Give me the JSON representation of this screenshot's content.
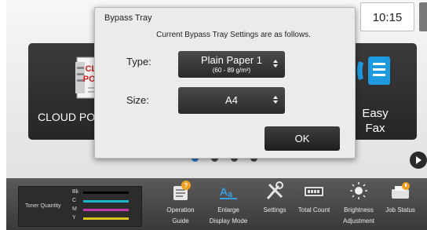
{
  "status": {
    "time": "10:15"
  },
  "tiles": {
    "cloud_portal": {
      "label": "CLOUD POR",
      "logo_line1": "CLOUD",
      "logo_line2": "PORTAL"
    },
    "easy_fax": {
      "label_line1": "Easy",
      "label_line2": "Fax"
    }
  },
  "pager": {
    "count": 4,
    "active_index": 0
  },
  "dialog": {
    "title": "Bypass Tray",
    "message": "Current Bypass Tray Settings are as follows.",
    "type_label": "Type:",
    "type_value": "Plain Paper 1",
    "type_subvalue": "(60 - 89 g/m²)",
    "size_label": "Size:",
    "size_value": "A4",
    "ok_label": "OK"
  },
  "bottom_bar": {
    "toner": {
      "label": "Toner Quantity",
      "rows": [
        {
          "letter": "Bk",
          "color": "#000000"
        },
        {
          "letter": "C",
          "color": "#19b5c8"
        },
        {
          "letter": "M",
          "color": "#c23aa9"
        },
        {
          "letter": "Y",
          "color": "#d7c31b"
        }
      ]
    },
    "items": [
      {
        "label1": "Operation",
        "label2": "Guide",
        "icon": "operation-guide-icon"
      },
      {
        "label1": "Enlarge",
        "label2": "Display Mode",
        "icon": "enlarge-display-icon"
      },
      {
        "label1": "Settings",
        "label2": "",
        "icon": "settings-tools-icon"
      },
      {
        "label1": "Total Count",
        "label2": "",
        "icon": "counter-icon"
      },
      {
        "label1": "Brightness",
        "label2": "Adjustment",
        "icon": "brightness-icon"
      },
      {
        "label1": "Job Status",
        "label2": "",
        "icon": "job-status-icon"
      }
    ]
  },
  "colors": {
    "accent_dot": "#2b78c8",
    "tile_bg": "#2e2e2e",
    "dialog_bg": "#ebebeb"
  }
}
